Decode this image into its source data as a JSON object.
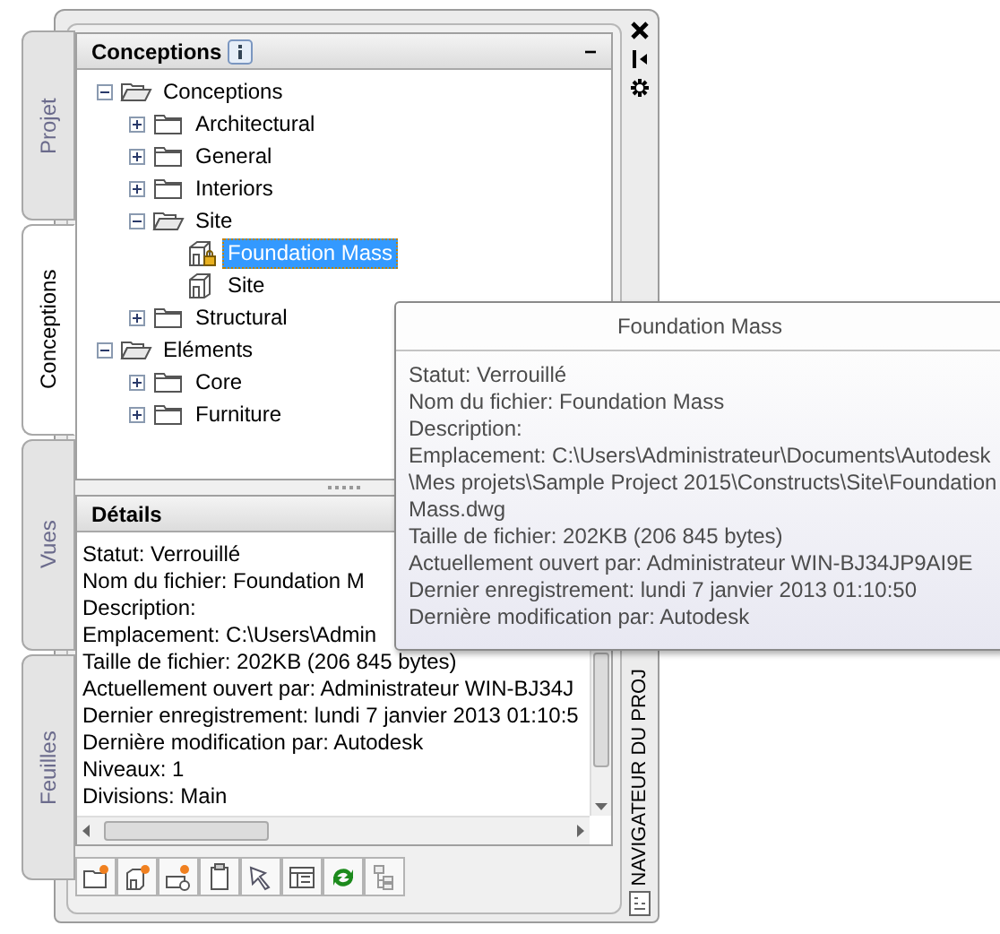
{
  "side_tabs": [
    {
      "label": "Projet",
      "selected": false
    },
    {
      "label": "Conceptions",
      "selected": true
    },
    {
      "label": "Vues",
      "selected": false
    },
    {
      "label": "Feuilles",
      "selected": false
    }
  ],
  "conceptions_pane": {
    "title": "Conceptions",
    "collapse_button": "−",
    "tree": [
      {
        "label": "Conceptions",
        "kind": "folder",
        "expanded": true,
        "selected": false,
        "children": [
          {
            "label": "Architectural",
            "kind": "folder",
            "expanded": false,
            "selected": false
          },
          {
            "label": "General",
            "kind": "folder",
            "expanded": false,
            "selected": false
          },
          {
            "label": "Interiors",
            "kind": "folder",
            "expanded": false,
            "selected": false
          },
          {
            "label": "Site",
            "kind": "folder",
            "expanded": true,
            "selected": false,
            "children": [
              {
                "label": "Foundation Mass",
                "kind": "drawing",
                "locked": true,
                "selected": true
              },
              {
                "label": "Site",
                "kind": "drawing",
                "locked": false,
                "selected": false
              }
            ]
          },
          {
            "label": "Structural",
            "kind": "folder",
            "expanded": false,
            "selected": false
          }
        ]
      },
      {
        "label": "Eléments",
        "kind": "folder",
        "expanded": true,
        "selected": false,
        "children": [
          {
            "label": "Core",
            "kind": "folder",
            "expanded": false,
            "selected": false
          },
          {
            "label": "Furniture",
            "kind": "folder",
            "expanded": false,
            "selected": false
          }
        ]
      }
    ]
  },
  "details": {
    "title": "Détails",
    "lines": [
      "Statut: Verrouillé",
      "Nom du fichier: Foundation M",
      "Description:",
      "Emplacement: C:\\Users\\Admin",
      "Taille de fichier: 202KB (206 845 bytes)",
      "Actuellement ouvert par: Administrateur WIN-BJ34J",
      "Dernier enregistrement: lundi 7 janvier 2013  01:10:5",
      "Dernière modification par: Autodesk",
      "Niveaux: 1",
      "Divisions: Main"
    ]
  },
  "tooltip": {
    "title": "Foundation Mass",
    "lines": [
      "Statut: Verrouillé",
      "Nom du fichier: Foundation Mass",
      "Description:",
      "Emplacement: C:\\Users\\Administrateur\\Documents\\Autodesk",
      "\\Mes projets\\Sample Project 2015\\Constructs\\Site\\Foundation",
      "Mass.dwg",
      "Taille de fichier: 202KB (206 845 bytes)",
      "Actuellement ouvert par: Administrateur WIN-BJ34JP9AI9E",
      "Dernier enregistrement: lundi 7 janvier 2013  01:10:50",
      "Dernière modification par: Autodesk"
    ]
  },
  "panel_title": "NAVIGATEUR DU PROJ"
}
